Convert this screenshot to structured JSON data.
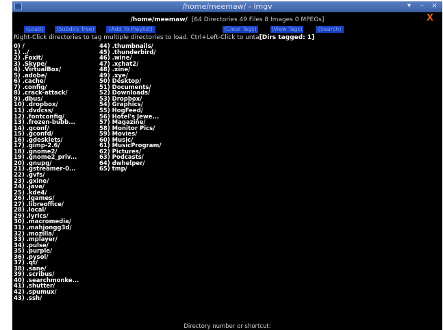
{
  "window": {
    "title": "/home/meemaw/ - imgv",
    "controls": {
      "minimize": "▾",
      "maximize": "–",
      "close": "×"
    },
    "close_x": "X"
  },
  "header": {
    "path": "/home/meemaw/",
    "stats": "[64 Directories  49 Files  8 Images  0 MPEGs]"
  },
  "buttons": [
    {
      "name": "load-button",
      "label": "(Load)"
    },
    {
      "name": "subdirs-tree-button",
      "label": "(Subdirs Tree)"
    },
    {
      "name": "add-to-playlist-button",
      "label": "(Add To Playlist)"
    },
    {
      "name": "clear-tags-button",
      "label": "(Clear Tags)"
    },
    {
      "name": "view-tags-button",
      "label": "(View Tags)"
    },
    {
      "name": "search-button",
      "label": "(Search)"
    }
  ],
  "instructions": {
    "text": "Right-Click directories to tag multiple directories to load. Ctrl+Left-Click to unta",
    "tagged": "[Dirs tagged: 1]"
  },
  "dirs_left": [
    "0) /",
    "1) ../",
    "2) .Foxit/",
    "3) .Skype/",
    "4) .VirtualBox/",
    "5) .adobe/",
    "6) .cache/",
    "7) .config/",
    "8) .crack-attack/",
    "9) .dbus/",
    "10) .dropbox/",
    "11) .dvdcss/",
    "12) .fontconfig/",
    "13) .frozen-bubb...",
    "14) .gconf/",
    "15) .gconfd/",
    "16) .gdesklets/",
    "17) .gimp-2.6/",
    "18) .gnome2/",
    "19) .gnome2_priv...",
    "20) .gnupg/",
    "21) .gstreamer-0...",
    "22) .gvfs/",
    "23) .gxine/",
    "24) .java/",
    "25) .kde4/",
    "26) .lgames/",
    "27) .libreoffice/",
    "28) .local/",
    "29) .lyrics/",
    "30) .macromedia/",
    "31) .mahjongg3d/",
    "32) .mozilla/",
    "33) .mplayer/",
    "34) .pulse/",
    "35) .purple/",
    "36) .pysol/",
    "37) .qt/",
    "38) .sane/",
    "39) .scribus/",
    "40) .searchmonke...",
    "41) .shutter/",
    "42) .spumux/",
    "43) .ssh/"
  ],
  "dirs_right": [
    "44) .thumbnails/",
    "45) .thunderbird/",
    "46) .wine/",
    "47) .xchat2/",
    "48) .xine/",
    "49) .xye/",
    "50) Desktop/",
    "51) Documents/",
    "52) Downloads/",
    "53) Dropbox/",
    "54) Graphics/",
    "55) HogFeed/",
    "56) Hotel's Jewe...",
    "57) Magazine/",
    "58) Monitor Pics/",
    "59) Movies/",
    "60) Music/",
    "61) MusicProgram/",
    "62) Pictures/",
    "63) Podcasts/",
    "64) dwhelper/",
    "65) tmp/"
  ],
  "status": "Directory number or shortcut:",
  "colors": {
    "background": "#000000",
    "button_bg": "#1a3fbf",
    "button_text": "#7fa8ff",
    "titlebar": "#4a70b6",
    "close_x": "#e8641b"
  }
}
